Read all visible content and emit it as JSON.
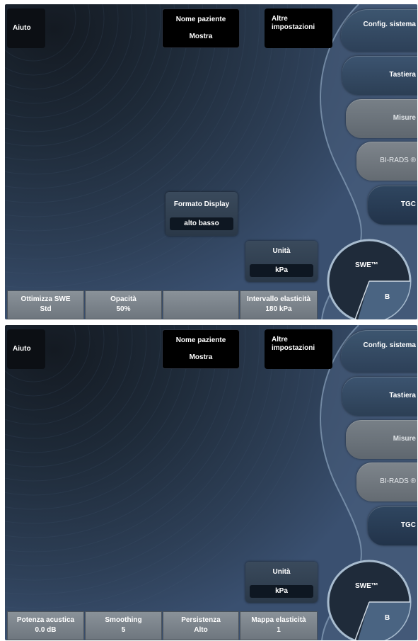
{
  "screens": [
    {
      "help_label": "Aiuto",
      "patient_name": {
        "title": "Nome paziente",
        "value": "Mostra"
      },
      "more_settings_label": "Altre impostazioni",
      "side_buttons": {
        "config": "Config. sistema",
        "keyboard": "Tastiera",
        "measures": "Misure",
        "birads": "BI-RADS ®",
        "tgc": "TGC"
      },
      "display_format": {
        "label": "Formato Display",
        "value": "alto basso"
      },
      "units": {
        "label": "Unità",
        "value": "kPa"
      },
      "dial": {
        "mode_label": "SWE™",
        "b_label": "B"
      },
      "bottom_controls": [
        {
          "label": "Ottimizza SWE",
          "value": "Std"
        },
        {
          "label": "Opacità",
          "value": "50%"
        },
        {
          "label": "",
          "value": ""
        },
        {
          "label": "Intervallo elasticità",
          "value": "180 kPa"
        }
      ]
    },
    {
      "help_label": "Aiuto",
      "patient_name": {
        "title": "Nome paziente",
        "value": "Mostra"
      },
      "more_settings_label": "Altre impostazioni",
      "side_buttons": {
        "config": "Config. sistema",
        "keyboard": "Tastiera",
        "measures": "Misure",
        "birads": "BI-RADS ®",
        "tgc": "TGC"
      },
      "units": {
        "label": "Unità",
        "value": "kPa"
      },
      "dial": {
        "mode_label": "SWE™",
        "b_label": "B"
      },
      "bottom_controls": [
        {
          "label": "Potenza acustica",
          "value": "0.0 dB"
        },
        {
          "label": "Smoothing",
          "value": "5"
        },
        {
          "label": "Persistenza",
          "value": "Alto"
        },
        {
          "label": "Mappa elasticità",
          "value": "1"
        }
      ]
    }
  ]
}
